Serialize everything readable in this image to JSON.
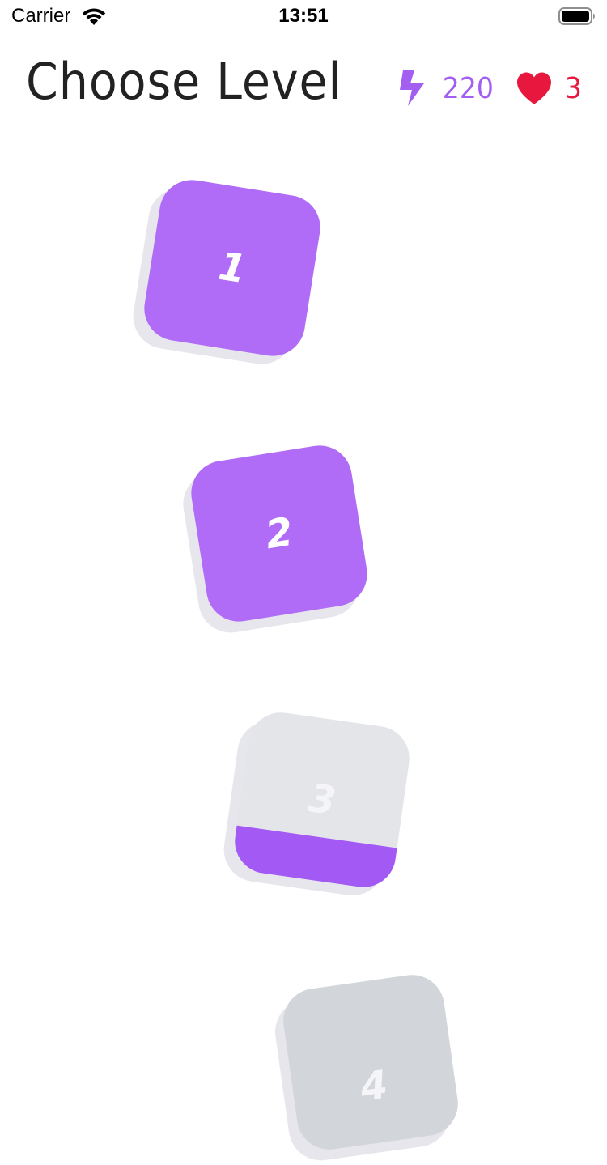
{
  "status_bar": {
    "carrier": "Carrier",
    "time": "13:51",
    "icons": [
      "wifi-icon",
      "battery-icon"
    ]
  },
  "header": {
    "title": "Choose Level",
    "energy": "220",
    "lives": "3",
    "energy_icon": "bolt-icon",
    "lives_icon": "heart-icon"
  },
  "colors": {
    "accent_purple": "#b06cf7",
    "fill_purple": "#a35af5",
    "energy": "#a25ff2",
    "lives": "#e8173d",
    "locked": "#d2d5da",
    "tile_shadow": "#e6e6ec"
  },
  "levels": [
    {
      "label": "1",
      "state": "unlocked",
      "progress": 1.0
    },
    {
      "label": "2",
      "state": "unlocked",
      "progress": 1.0
    },
    {
      "label": "3",
      "state": "in-progress",
      "progress": 0.27
    },
    {
      "label": "4",
      "state": "locked",
      "progress": 0.0
    }
  ]
}
